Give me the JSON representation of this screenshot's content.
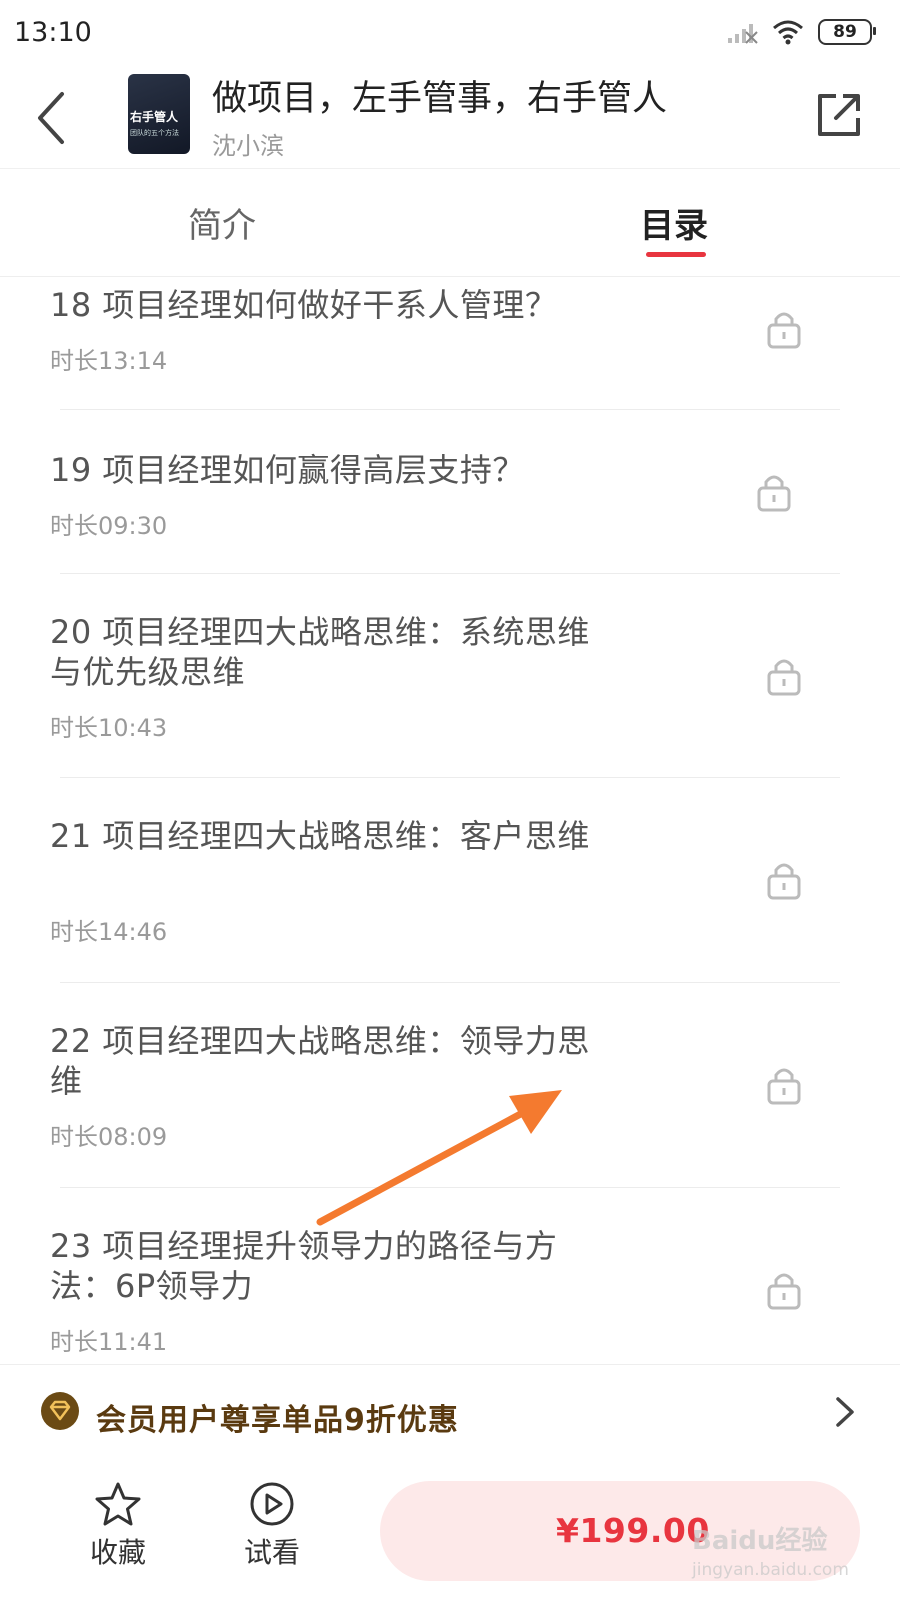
{
  "status": {
    "time": "13:10",
    "battery": "89",
    "icons": [
      "signal-icon",
      "wifi-icon",
      "battery-icon"
    ]
  },
  "header": {
    "back_icon": "back-arrow-icon",
    "cover_title": "右手管人",
    "cover_subtitle": "团队的五个方法",
    "title": "做项目，左手管事，右手管人",
    "author": "沈小滨",
    "share_icon": "share-icon"
  },
  "tabs": [
    {
      "label": "简介",
      "active": false
    },
    {
      "label": "目录",
      "active": true
    }
  ],
  "accent_color": "#e8353f",
  "chapters": [
    {
      "title": "18 项目经理如何做好干系人管理？",
      "duration": "时长13:14",
      "locked": true
    },
    {
      "title": "19 项目经理如何赢得高层支持？",
      "duration": "时长09:30",
      "locked": true
    },
    {
      "title": "20 项目经理四大战略思维：系统思维与优先级思维",
      "duration": "时长10:43",
      "locked": true
    },
    {
      "title": "21 项目经理四大战略思维：客户思维",
      "duration": "时长14:46",
      "locked": true
    },
    {
      "title": "22 项目经理四大战略思维：领导力思维",
      "duration": "时长08:09",
      "locked": true
    },
    {
      "title": "23 项目经理提升领导力的路径与方法：6P领导力",
      "duration": "时长11:41",
      "locked": true
    }
  ],
  "member_banner": {
    "text": "会员用户尊享单品9折优惠",
    "icon": "vip-diamond-icon"
  },
  "bottom": {
    "favorite_label": "收藏",
    "trial_label": "试看",
    "price": "¥199.00"
  },
  "watermark": {
    "brand": "Baidu经验",
    "url": "jingyan.baidu.com"
  }
}
